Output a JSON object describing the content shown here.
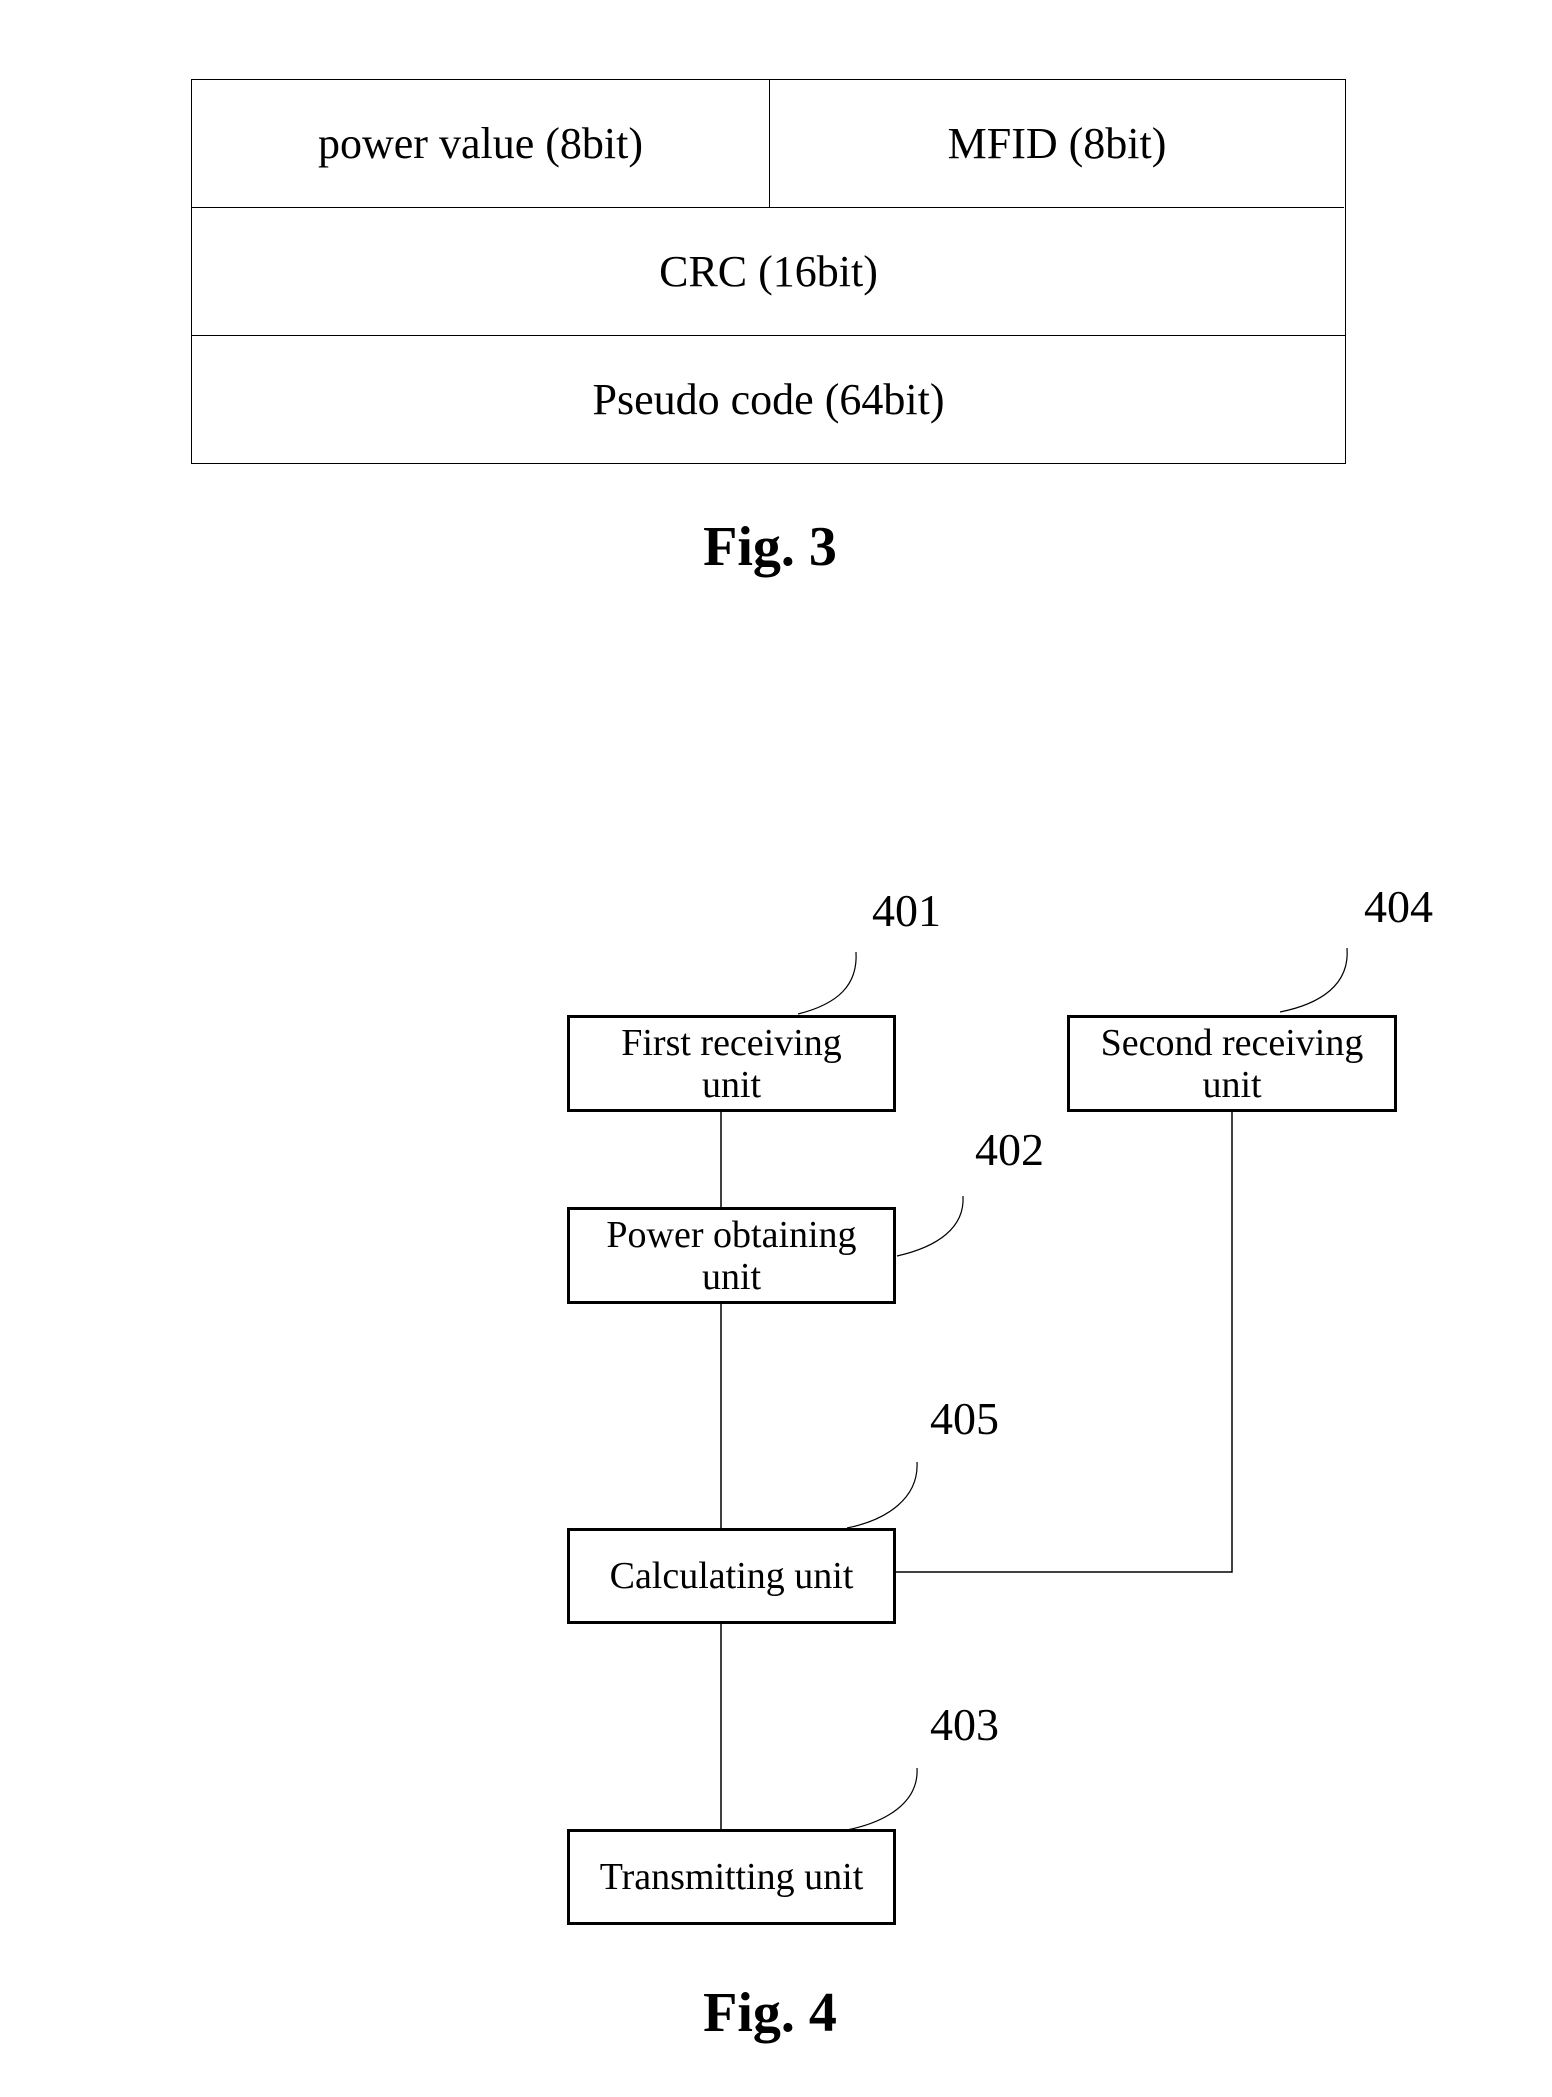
{
  "fig3": {
    "caption": "Fig. 3",
    "fields": {
      "power_value": "power value (8bit)",
      "mfid": "MFID (8bit)",
      "crc": "CRC (16bit)",
      "pseudo_code": "Pseudo code (64bit)"
    }
  },
  "fig4": {
    "caption": "Fig. 4",
    "units": {
      "first_receiving": {
        "ref": "401",
        "label": "First receiving unit"
      },
      "power_obtaining": {
        "ref": "402",
        "label": "Power obtaining unit"
      },
      "transmitting": {
        "ref": "403",
        "label": "Transmitting unit"
      },
      "second_receiving": {
        "ref": "404",
        "label": "Second  receiving unit"
      },
      "calculating": {
        "ref": "405",
        "label": "Calculating unit"
      }
    },
    "connections": [
      [
        "401",
        "402"
      ],
      [
        "402",
        "405"
      ],
      [
        "404",
        "405"
      ],
      [
        "405",
        "403"
      ]
    ]
  }
}
